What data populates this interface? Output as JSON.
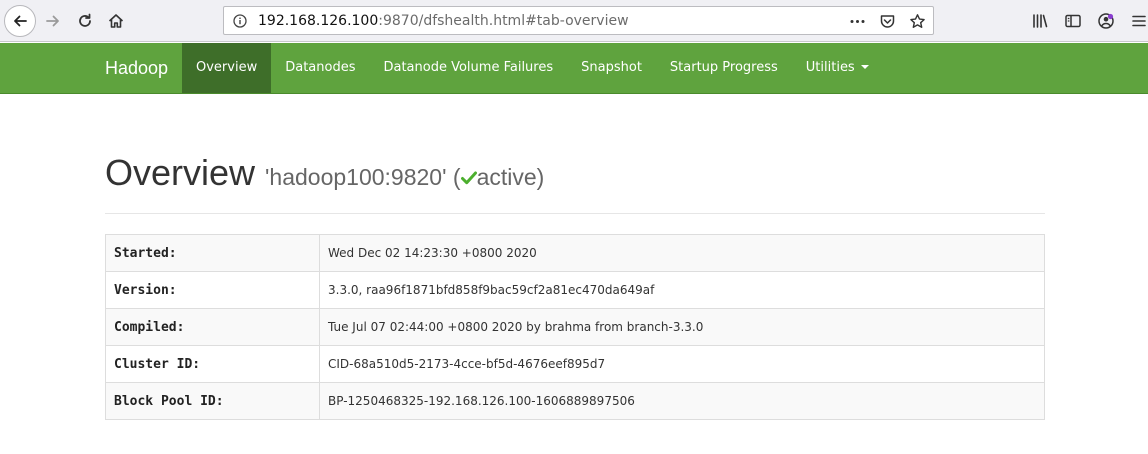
{
  "browser": {
    "url_host": "192.168.126.100",
    "url_rest": ":9870/dfshealth.html#tab-overview",
    "icons": [
      "back-icon",
      "forward-icon",
      "reload-icon",
      "home-icon",
      "info-icon",
      "more-icon",
      "pocket-icon",
      "bookmark-star-icon",
      "library-icon",
      "sidebar-icon",
      "account-icon",
      "menu-icon"
    ]
  },
  "navbar": {
    "brand": "Hadoop",
    "items": [
      {
        "label": "Overview",
        "active": true
      },
      {
        "label": "Datanodes"
      },
      {
        "label": "Datanode Volume Failures"
      },
      {
        "label": "Snapshot"
      },
      {
        "label": "Startup Progress"
      },
      {
        "label": "Utilities"
      }
    ],
    "colors": {
      "bar": "#5fa33e",
      "active": "#3e6e29"
    }
  },
  "header": {
    "title": "Overview",
    "host": "'hadoop100:9820'",
    "open_paren": "(",
    "status": "active",
    "close_paren": ")",
    "status_color": "#4caf2e"
  },
  "overview": {
    "rows": [
      {
        "key": "Started:",
        "value": "Wed Dec 02 14:23:30 +0800 2020"
      },
      {
        "key": "Version:",
        "value": "3.3.0, raa96f1871bfd858f9bac59cf2a81ec470da649af"
      },
      {
        "key": "Compiled:",
        "value": "Tue Jul 07 02:44:00 +0800 2020 by brahma from branch-3.3.0"
      },
      {
        "key": "Cluster ID:",
        "value": "CID-68a510d5-2173-4cce-bf5d-4676eef895d7"
      },
      {
        "key": "Block Pool ID:",
        "value": "BP-1250468325-192.168.126.100-1606889897506"
      }
    ]
  }
}
